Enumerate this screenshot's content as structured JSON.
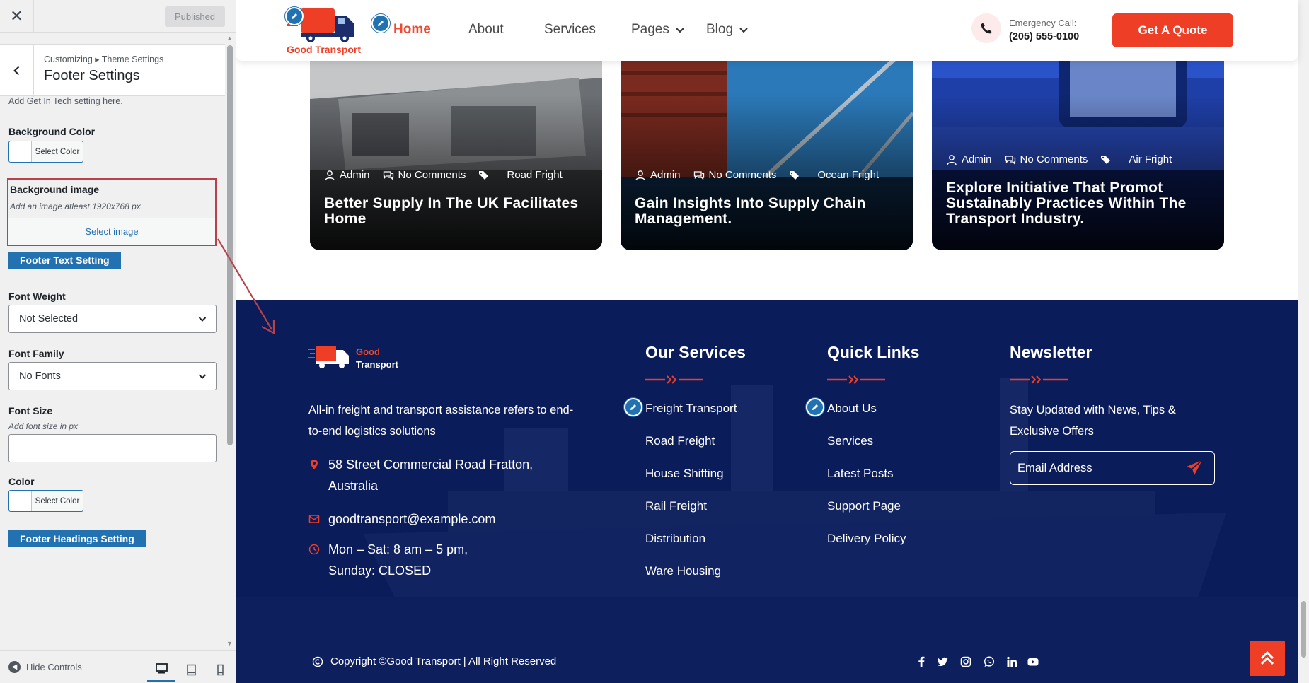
{
  "sidebar": {
    "close_icon": "close-icon",
    "published_label": "Published",
    "breadcrumb": "Customizing ▸ Theme Settings",
    "title": "Footer Settings",
    "description": "Add Get In Tech setting here.",
    "bg_color_label": "Background Color",
    "select_color_label": "Select Color",
    "bg_image_label": "Background image",
    "bg_image_hint": "Add an image atleast 1920x768 px",
    "select_image_label": "Select image",
    "footer_text_setting": "Footer Text Setting",
    "font_weight_label": "Font Weight",
    "font_weight_value": "Not Selected",
    "font_family_label": "Font Family",
    "font_family_value": "No Fonts",
    "font_size_label": "Font Size",
    "font_size_hint": "Add font size in px",
    "font_size_value": "",
    "color_label": "Color",
    "footer_headings_setting": "Footer Headings Setting",
    "hide_controls": "Hide Controls"
  },
  "header": {
    "logo_text": "Good Transport",
    "nav": [
      "Home",
      "About",
      "Services",
      "Pages",
      "Blog"
    ],
    "emergency_label": "Emergency Call:",
    "emergency_number": "(205) 555-0100",
    "quote_button": "Get A Quote"
  },
  "blog": [
    {
      "author": "Admin",
      "comments": "No Comments",
      "category": "Road Fright",
      "title": "Better Supply In The UK Facilitates Home"
    },
    {
      "author": "Admin",
      "comments": "No Comments",
      "category": "Ocean Fright",
      "title": "Gain Insights Into Supply Chain Management."
    },
    {
      "author": "Admin",
      "comments": "No Comments",
      "category": "Air Fright",
      "title": "Explore Initiative That Promot Sustainably Practices Within The Transport Industry."
    }
  ],
  "footer": {
    "logo_good": "Good",
    "logo_transport": "Transport",
    "about": "All-in freight and transport assistance refers to end-to-end logistics solutions",
    "address": "58 Street Commercial Road Fratton, Australia",
    "email": "goodtransport@example.com",
    "hours": "Mon – Sat: 8 am – 5 pm, Sunday: CLOSED",
    "services_heading": "Our Services",
    "services": [
      "Freight Transport",
      "Road Freight",
      "House Shifting",
      "Rail Freight",
      "Distribution",
      "Ware Housing"
    ],
    "quick_heading": "Quick Links",
    "quick_links": [
      "About Us",
      "Services",
      "Latest Posts",
      "Support Page",
      "Delivery Policy"
    ],
    "newsletter_heading": "Newsletter",
    "newsletter_text": "Stay Updated with News, Tips & Exclusive Offers",
    "email_placeholder": "Email Address",
    "copyright": "Copyright ©Good Transport | All Right Reserved"
  },
  "colors": {
    "accent": "#ee3e26",
    "footer_bg": "#0b1c5a",
    "wp_blue": "#2271b1",
    "annotation": "#b7424c"
  }
}
